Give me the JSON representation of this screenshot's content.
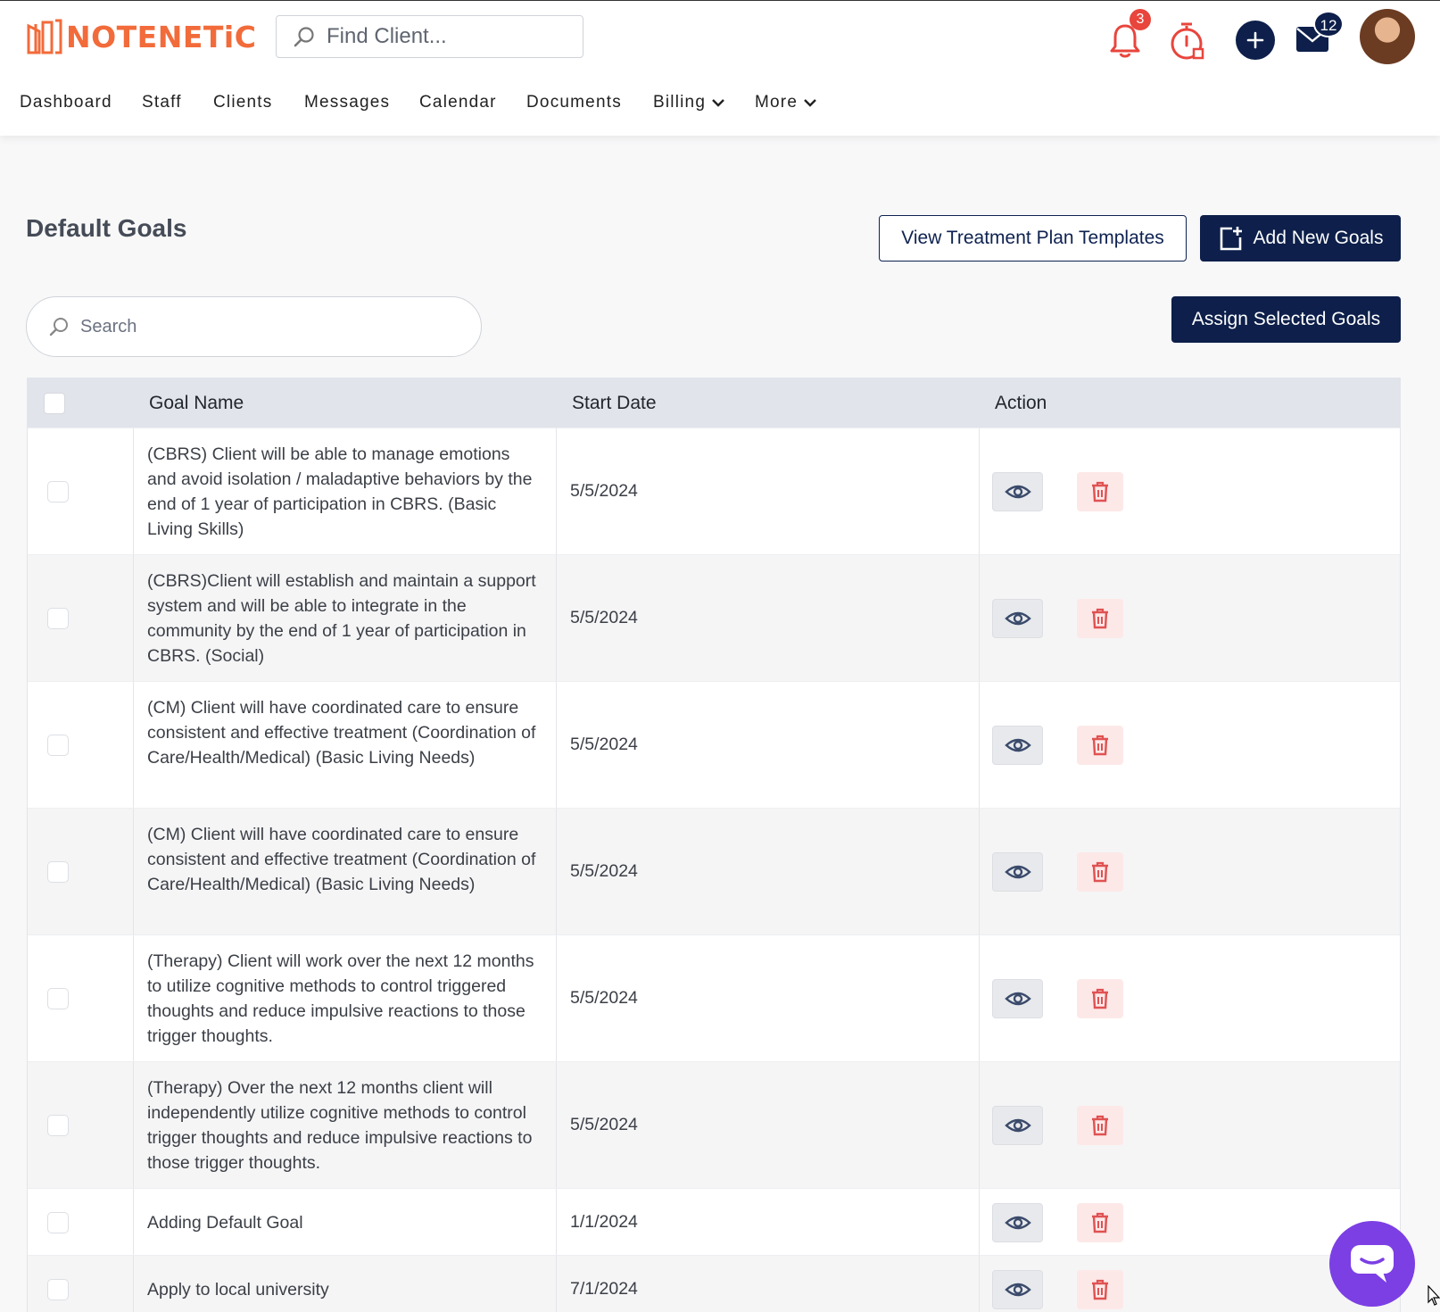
{
  "brand": {
    "name": "NOTENETiC",
    "color": "#f26b3a"
  },
  "header": {
    "find_placeholder": "Find Client...",
    "notifications_count": "3",
    "messages_count": "12",
    "icons": [
      "bell-icon",
      "timer-icon",
      "plus-icon",
      "mail-icon"
    ]
  },
  "nav": {
    "items": [
      {
        "label": "Dashboard"
      },
      {
        "label": "Staff"
      },
      {
        "label": "Clients"
      },
      {
        "label": "Messages"
      },
      {
        "label": "Calendar"
      },
      {
        "label": "Documents"
      },
      {
        "label": "Billing"
      },
      {
        "label": "More"
      }
    ]
  },
  "page": {
    "title": "Default Goals",
    "view_templates_label": "View Treatment Plan Templates",
    "add_goals_label": "Add New Goals",
    "assign_label": "Assign Selected Goals",
    "search_placeholder": "Search"
  },
  "table": {
    "columns": [
      "Goal Name",
      "Start Date",
      "Action"
    ],
    "rows": [
      {
        "goal": "(CBRS) Client will be able to manage emotions and avoid isolation / maladaptive behaviors by the end of 1 year of participation in CBRS. (Basic Living Skills)",
        "date": "5/5/2024"
      },
      {
        "goal": "(CBRS)Client will establish and maintain a support system and will be able to integrate in the community by the end of 1 year of participation in CBRS. (Social)",
        "date": "5/5/2024"
      },
      {
        "goal": "(CM) Client will have coordinated care to ensure consistent and effective treatment (Coordination of Care/Health/Medical) (Basic Living Needs)",
        "date": "5/5/2024"
      },
      {
        "goal": "(CM) Client will have coordinated care to ensure consistent and effective treatment (Coordination of Care/Health/Medical) (Basic Living Needs)",
        "date": "5/5/2024"
      },
      {
        "goal": "(Therapy) Client will work over the next 12 months to utilize cognitive methods to control triggered thoughts and reduce impulsive reactions to those trigger thoughts.",
        "date": "5/5/2024"
      },
      {
        "goal": "(Therapy) Over the next 12 months client will independently utilize cognitive methods to control trigger thoughts and reduce impulsive reactions to those trigger thoughts.",
        "date": "5/5/2024"
      },
      {
        "goal": "Adding Default Goal",
        "date": "1/1/2024"
      },
      {
        "goal": "Apply to local university",
        "date": "7/1/2024"
      }
    ]
  },
  "colors": {
    "primary": "#0d1f4a",
    "danger": "#e05252",
    "chat": "#7b3fe4"
  }
}
